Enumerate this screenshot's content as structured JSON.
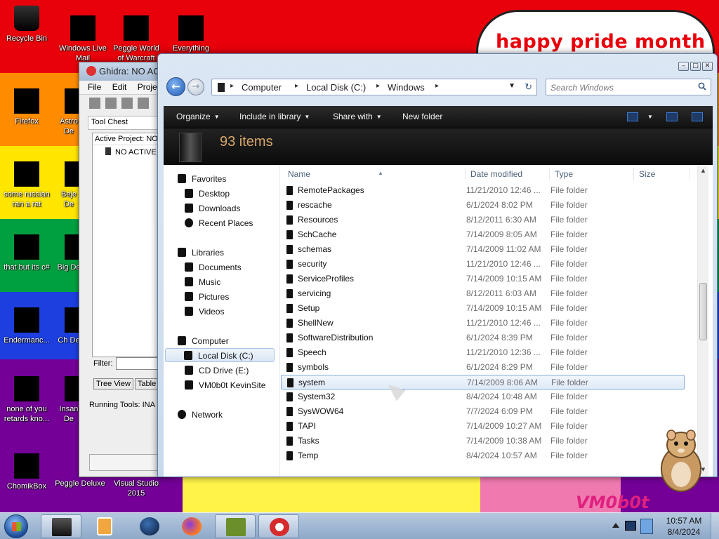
{
  "desktop": {
    "banner_text": "happy pride month",
    "signature": "VM0b0t",
    "icons": [
      {
        "label": "Recycle Bin"
      },
      {
        "label": "Windows Live Mail"
      },
      {
        "label": "Peggle World of Warcraft"
      },
      {
        "label": "Everything"
      },
      {
        "label": "Firefox"
      },
      {
        "label": "Astro De"
      },
      {
        "label": "some russian ran a rat"
      },
      {
        "label": "Beje De"
      },
      {
        "label": "that but its c#"
      },
      {
        "label": "Big De"
      },
      {
        "label": "Endermanc..."
      },
      {
        "label": "Ch De"
      },
      {
        "label": "none of you retards kno..."
      },
      {
        "label": "Insan De"
      },
      {
        "label": "ChomikBox"
      },
      {
        "label": "Peggle Deluxe"
      },
      {
        "label": "Visual Studio 2015"
      }
    ]
  },
  "ghidra": {
    "title": "Ghidra: NO ACT",
    "menu": [
      "File",
      "Edit",
      "Projec"
    ],
    "tool_chest": "Tool Chest",
    "active_project": "Active Project: NO",
    "tree_node": "NO ACTIVE",
    "filter_label": "Filter:",
    "tabs": [
      "Tree View",
      "Table"
    ],
    "running_tools": "Running Tools: INA"
  },
  "explorer": {
    "window_controls": [
      "–",
      "□",
      "✕"
    ],
    "breadcrumbs": [
      "Computer",
      "Local Disk (C:)",
      "Windows"
    ],
    "search_placeholder": "Search Windows",
    "commands": {
      "organize": "Organize",
      "include_in_library": "Include in library",
      "share_with": "Share with",
      "new_folder": "New folder"
    },
    "item_count": "93 items",
    "nav_pane": {
      "favorites": "Favorites",
      "favorites_items": [
        "Desktop",
        "Downloads",
        "Recent Places"
      ],
      "libraries": "Libraries",
      "libraries_items": [
        "Documents",
        "Music",
        "Pictures",
        "Videos"
      ],
      "computer": "Computer",
      "computer_items": [
        "Local Disk (C:)",
        "CD Drive (E:)",
        "VM0b0t KevinSite"
      ],
      "network": "Network"
    },
    "columns": {
      "name": "Name",
      "date": "Date modified",
      "type": "Type",
      "size": "Size"
    },
    "rows": [
      {
        "name": "RemotePackages",
        "date": "11/21/2010 12:46 ...",
        "type": "File folder"
      },
      {
        "name": "rescache",
        "date": "6/1/2024 8:02 PM",
        "type": "File folder"
      },
      {
        "name": "Resources",
        "date": "8/12/2011 6:30 AM",
        "type": "File folder"
      },
      {
        "name": "SchCache",
        "date": "7/14/2009 8:05 AM",
        "type": "File folder"
      },
      {
        "name": "schemas",
        "date": "7/14/2009 11:02 AM",
        "type": "File folder"
      },
      {
        "name": "security",
        "date": "11/21/2010 12:46 ...",
        "type": "File folder"
      },
      {
        "name": "ServiceProfiles",
        "date": "7/14/2009 10:15 AM",
        "type": "File folder"
      },
      {
        "name": "servicing",
        "date": "8/12/2011 6:03 AM",
        "type": "File folder"
      },
      {
        "name": "Setup",
        "date": "7/14/2009 10:15 AM",
        "type": "File folder"
      },
      {
        "name": "ShellNew",
        "date": "11/21/2010 12:46 ...",
        "type": "File folder"
      },
      {
        "name": "SoftwareDistribution",
        "date": "6/1/2024 8:39 PM",
        "type": "File folder"
      },
      {
        "name": "Speech",
        "date": "11/21/2010 12:36 ...",
        "type": "File folder"
      },
      {
        "name": "symbols",
        "date": "6/1/2024 8:29 PM",
        "type": "File folder"
      },
      {
        "name": "system",
        "date": "7/14/2009 8:06 AM",
        "type": "File folder"
      },
      {
        "name": "System32",
        "date": "8/4/2024 10:48 AM",
        "type": "File folder"
      },
      {
        "name": "SysWOW64",
        "date": "7/7/2024 6:09 PM",
        "type": "File folder"
      },
      {
        "name": "TAPI",
        "date": "7/14/2009 10:27 AM",
        "type": "File folder"
      },
      {
        "name": "Tasks",
        "date": "7/14/2009 10:38 AM",
        "type": "File folder"
      },
      {
        "name": "Temp",
        "date": "8/4/2024 10:57 AM",
        "type": "File folder"
      }
    ],
    "selected_row": "system"
  },
  "taskbar": {
    "clock_time": "10:57 AM",
    "clock_date": "8/4/2024"
  }
}
